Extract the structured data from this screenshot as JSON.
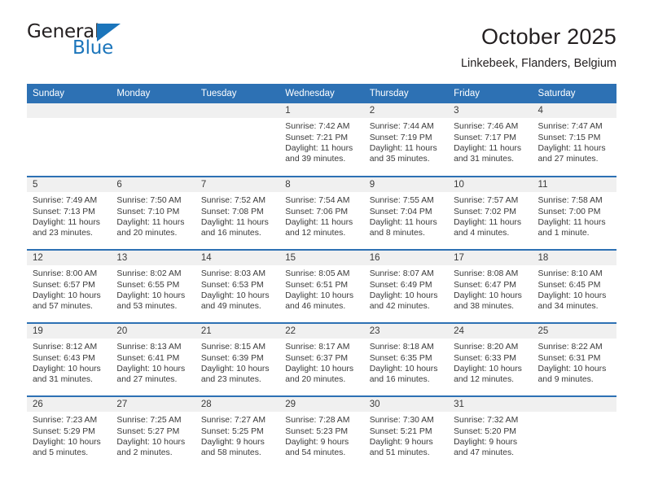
{
  "brand": {
    "name_part1": "General",
    "name_part2": "Blue",
    "triangle_color": "#1b75bb"
  },
  "header": {
    "title": "October 2025",
    "subtitle": "Linkebeek, Flanders, Belgium"
  },
  "colors": {
    "header_blue": "#2d71b4",
    "daynum_band": "#f0f0f0",
    "text": "#3a3a3a"
  },
  "calendar": {
    "weekday_headers": [
      "Sunday",
      "Monday",
      "Tuesday",
      "Wednesday",
      "Thursday",
      "Friday",
      "Saturday"
    ],
    "weeks": [
      [
        {
          "day": "",
          "empty": true,
          "sunrise": "",
          "sunset": "",
          "daylight_line1": "",
          "daylight_line2": ""
        },
        {
          "day": "",
          "empty": true,
          "sunrise": "",
          "sunset": "",
          "daylight_line1": "",
          "daylight_line2": ""
        },
        {
          "day": "",
          "empty": true,
          "sunrise": "",
          "sunset": "",
          "daylight_line1": "",
          "daylight_line2": ""
        },
        {
          "day": "1",
          "empty": false,
          "sunrise": "Sunrise: 7:42 AM",
          "sunset": "Sunset: 7:21 PM",
          "daylight_line1": "Daylight: 11 hours",
          "daylight_line2": "and 39 minutes."
        },
        {
          "day": "2",
          "empty": false,
          "sunrise": "Sunrise: 7:44 AM",
          "sunset": "Sunset: 7:19 PM",
          "daylight_line1": "Daylight: 11 hours",
          "daylight_line2": "and 35 minutes."
        },
        {
          "day": "3",
          "empty": false,
          "sunrise": "Sunrise: 7:46 AM",
          "sunset": "Sunset: 7:17 PM",
          "daylight_line1": "Daylight: 11 hours",
          "daylight_line2": "and 31 minutes."
        },
        {
          "day": "4",
          "empty": false,
          "sunrise": "Sunrise: 7:47 AM",
          "sunset": "Sunset: 7:15 PM",
          "daylight_line1": "Daylight: 11 hours",
          "daylight_line2": "and 27 minutes."
        }
      ],
      [
        {
          "day": "5",
          "empty": false,
          "sunrise": "Sunrise: 7:49 AM",
          "sunset": "Sunset: 7:13 PM",
          "daylight_line1": "Daylight: 11 hours",
          "daylight_line2": "and 23 minutes."
        },
        {
          "day": "6",
          "empty": false,
          "sunrise": "Sunrise: 7:50 AM",
          "sunset": "Sunset: 7:10 PM",
          "daylight_line1": "Daylight: 11 hours",
          "daylight_line2": "and 20 minutes."
        },
        {
          "day": "7",
          "empty": false,
          "sunrise": "Sunrise: 7:52 AM",
          "sunset": "Sunset: 7:08 PM",
          "daylight_line1": "Daylight: 11 hours",
          "daylight_line2": "and 16 minutes."
        },
        {
          "day": "8",
          "empty": false,
          "sunrise": "Sunrise: 7:54 AM",
          "sunset": "Sunset: 7:06 PM",
          "daylight_line1": "Daylight: 11 hours",
          "daylight_line2": "and 12 minutes."
        },
        {
          "day": "9",
          "empty": false,
          "sunrise": "Sunrise: 7:55 AM",
          "sunset": "Sunset: 7:04 PM",
          "daylight_line1": "Daylight: 11 hours",
          "daylight_line2": "and 8 minutes."
        },
        {
          "day": "10",
          "empty": false,
          "sunrise": "Sunrise: 7:57 AM",
          "sunset": "Sunset: 7:02 PM",
          "daylight_line1": "Daylight: 11 hours",
          "daylight_line2": "and 4 minutes."
        },
        {
          "day": "11",
          "empty": false,
          "sunrise": "Sunrise: 7:58 AM",
          "sunset": "Sunset: 7:00 PM",
          "daylight_line1": "Daylight: 11 hours",
          "daylight_line2": "and 1 minute."
        }
      ],
      [
        {
          "day": "12",
          "empty": false,
          "sunrise": "Sunrise: 8:00 AM",
          "sunset": "Sunset: 6:57 PM",
          "daylight_line1": "Daylight: 10 hours",
          "daylight_line2": "and 57 minutes."
        },
        {
          "day": "13",
          "empty": false,
          "sunrise": "Sunrise: 8:02 AM",
          "sunset": "Sunset: 6:55 PM",
          "daylight_line1": "Daylight: 10 hours",
          "daylight_line2": "and 53 minutes."
        },
        {
          "day": "14",
          "empty": false,
          "sunrise": "Sunrise: 8:03 AM",
          "sunset": "Sunset: 6:53 PM",
          "daylight_line1": "Daylight: 10 hours",
          "daylight_line2": "and 49 minutes."
        },
        {
          "day": "15",
          "empty": false,
          "sunrise": "Sunrise: 8:05 AM",
          "sunset": "Sunset: 6:51 PM",
          "daylight_line1": "Daylight: 10 hours",
          "daylight_line2": "and 46 minutes."
        },
        {
          "day": "16",
          "empty": false,
          "sunrise": "Sunrise: 8:07 AM",
          "sunset": "Sunset: 6:49 PM",
          "daylight_line1": "Daylight: 10 hours",
          "daylight_line2": "and 42 minutes."
        },
        {
          "day": "17",
          "empty": false,
          "sunrise": "Sunrise: 8:08 AM",
          "sunset": "Sunset: 6:47 PM",
          "daylight_line1": "Daylight: 10 hours",
          "daylight_line2": "and 38 minutes."
        },
        {
          "day": "18",
          "empty": false,
          "sunrise": "Sunrise: 8:10 AM",
          "sunset": "Sunset: 6:45 PM",
          "daylight_line1": "Daylight: 10 hours",
          "daylight_line2": "and 34 minutes."
        }
      ],
      [
        {
          "day": "19",
          "empty": false,
          "sunrise": "Sunrise: 8:12 AM",
          "sunset": "Sunset: 6:43 PM",
          "daylight_line1": "Daylight: 10 hours",
          "daylight_line2": "and 31 minutes."
        },
        {
          "day": "20",
          "empty": false,
          "sunrise": "Sunrise: 8:13 AM",
          "sunset": "Sunset: 6:41 PM",
          "daylight_line1": "Daylight: 10 hours",
          "daylight_line2": "and 27 minutes."
        },
        {
          "day": "21",
          "empty": false,
          "sunrise": "Sunrise: 8:15 AM",
          "sunset": "Sunset: 6:39 PM",
          "daylight_line1": "Daylight: 10 hours",
          "daylight_line2": "and 23 minutes."
        },
        {
          "day": "22",
          "empty": false,
          "sunrise": "Sunrise: 8:17 AM",
          "sunset": "Sunset: 6:37 PM",
          "daylight_line1": "Daylight: 10 hours",
          "daylight_line2": "and 20 minutes."
        },
        {
          "day": "23",
          "empty": false,
          "sunrise": "Sunrise: 8:18 AM",
          "sunset": "Sunset: 6:35 PM",
          "daylight_line1": "Daylight: 10 hours",
          "daylight_line2": "and 16 minutes."
        },
        {
          "day": "24",
          "empty": false,
          "sunrise": "Sunrise: 8:20 AM",
          "sunset": "Sunset: 6:33 PM",
          "daylight_line1": "Daylight: 10 hours",
          "daylight_line2": "and 12 minutes."
        },
        {
          "day": "25",
          "empty": false,
          "sunrise": "Sunrise: 8:22 AM",
          "sunset": "Sunset: 6:31 PM",
          "daylight_line1": "Daylight: 10 hours",
          "daylight_line2": "and 9 minutes."
        }
      ],
      [
        {
          "day": "26",
          "empty": false,
          "sunrise": "Sunrise: 7:23 AM",
          "sunset": "Sunset: 5:29 PM",
          "daylight_line1": "Daylight: 10 hours",
          "daylight_line2": "and 5 minutes."
        },
        {
          "day": "27",
          "empty": false,
          "sunrise": "Sunrise: 7:25 AM",
          "sunset": "Sunset: 5:27 PM",
          "daylight_line1": "Daylight: 10 hours",
          "daylight_line2": "and 2 minutes."
        },
        {
          "day": "28",
          "empty": false,
          "sunrise": "Sunrise: 7:27 AM",
          "sunset": "Sunset: 5:25 PM",
          "daylight_line1": "Daylight: 9 hours",
          "daylight_line2": "and 58 minutes."
        },
        {
          "day": "29",
          "empty": false,
          "sunrise": "Sunrise: 7:28 AM",
          "sunset": "Sunset: 5:23 PM",
          "daylight_line1": "Daylight: 9 hours",
          "daylight_line2": "and 54 minutes."
        },
        {
          "day": "30",
          "empty": false,
          "sunrise": "Sunrise: 7:30 AM",
          "sunset": "Sunset: 5:21 PM",
          "daylight_line1": "Daylight: 9 hours",
          "daylight_line2": "and 51 minutes."
        },
        {
          "day": "31",
          "empty": false,
          "sunrise": "Sunrise: 7:32 AM",
          "sunset": "Sunset: 5:20 PM",
          "daylight_line1": "Daylight: 9 hours",
          "daylight_line2": "and 47 minutes."
        },
        {
          "day": "",
          "empty": true,
          "sunrise": "",
          "sunset": "",
          "daylight_line1": "",
          "daylight_line2": ""
        }
      ]
    ]
  }
}
